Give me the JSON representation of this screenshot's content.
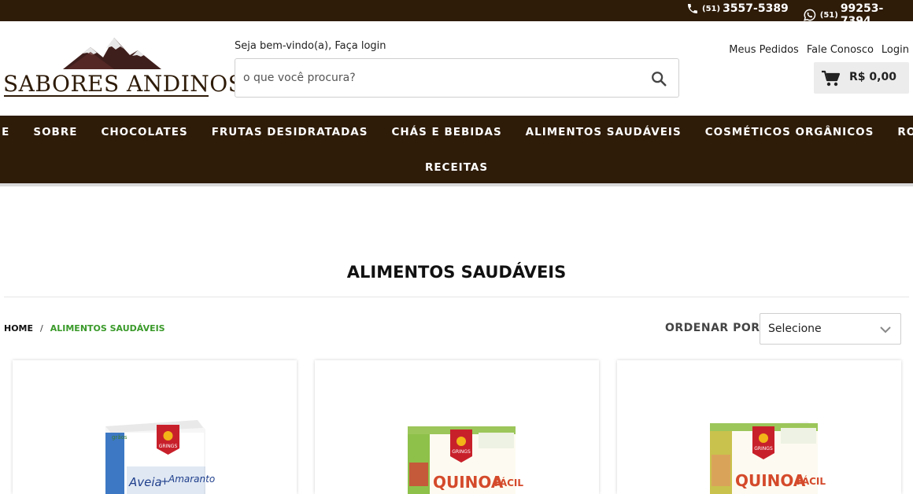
{
  "topbar": {
    "phone_prefix": "(51)",
    "phone_number": "3557-5389",
    "whatsapp_prefix": "(51)",
    "whatsapp_number": "99253-7394"
  },
  "brand": {
    "name": "SABORES ANDINOS"
  },
  "header": {
    "welcome_text": "Seja bem-vindo(a),",
    "login_prompt": "Faça login",
    "search_placeholder": "o que você procura?",
    "links": [
      "Meus Pedidos",
      "Fale Conosco",
      "Login"
    ],
    "cart_total": "R$ 0,00"
  },
  "nav": {
    "items": [
      "HOME",
      "SOBRE",
      "CHOCOLATES",
      "FRUTAS DESIDRATADAS",
      "CHÁS E BEBIDAS",
      "ALIMENTOS SAUDÁVEIS",
      "COSMÉTICOS ORGÂNICOS",
      "ROSAS"
    ],
    "items_row2": [
      "RECEITAS"
    ]
  },
  "page": {
    "title": "ALIMENTOS SAUDÁVEIS",
    "breadcrumb": [
      "HOME",
      "/",
      "ALIMENTOS SAUDÁVEIS"
    ],
    "sort_label": "ORDENAR POR:",
    "sort_value": "Selecione"
  },
  "products": [
    {
      "brand": "GRINGS",
      "line": "grãos",
      "name_left": "Aveia",
      "name_right": "Amaranto"
    },
    {
      "brand": "GRINGS",
      "name_left": "QUINOA",
      "name_right": "FÁCIL"
    },
    {
      "brand": "GRINGS",
      "name_left": "QUINOA",
      "name_right": "FÁCIL"
    }
  ],
  "colors": {
    "dark_brown": "#2e1b08",
    "breadcrumb_active": "#3a9a2a",
    "cart_bg": "#ececec"
  }
}
